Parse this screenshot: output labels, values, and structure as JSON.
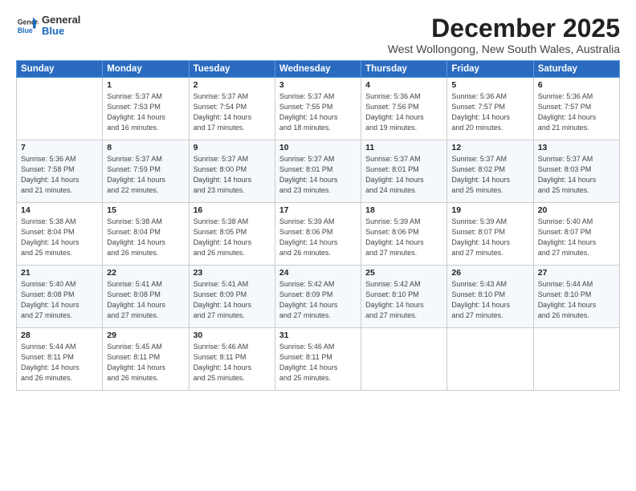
{
  "logo": {
    "general": "General",
    "blue": "Blue"
  },
  "title": "December 2025",
  "subtitle": "West Wollongong, New South Wales, Australia",
  "headers": [
    "Sunday",
    "Monday",
    "Tuesday",
    "Wednesday",
    "Thursday",
    "Friday",
    "Saturday"
  ],
  "weeks": [
    [
      {
        "day": "",
        "info": ""
      },
      {
        "day": "1",
        "info": "Sunrise: 5:37 AM\nSunset: 7:53 PM\nDaylight: 14 hours\nand 16 minutes."
      },
      {
        "day": "2",
        "info": "Sunrise: 5:37 AM\nSunset: 7:54 PM\nDaylight: 14 hours\nand 17 minutes."
      },
      {
        "day": "3",
        "info": "Sunrise: 5:37 AM\nSunset: 7:55 PM\nDaylight: 14 hours\nand 18 minutes."
      },
      {
        "day": "4",
        "info": "Sunrise: 5:36 AM\nSunset: 7:56 PM\nDaylight: 14 hours\nand 19 minutes."
      },
      {
        "day": "5",
        "info": "Sunrise: 5:36 AM\nSunset: 7:57 PM\nDaylight: 14 hours\nand 20 minutes."
      },
      {
        "day": "6",
        "info": "Sunrise: 5:36 AM\nSunset: 7:57 PM\nDaylight: 14 hours\nand 21 minutes."
      }
    ],
    [
      {
        "day": "7",
        "info": "Sunrise: 5:36 AM\nSunset: 7:58 PM\nDaylight: 14 hours\nand 21 minutes."
      },
      {
        "day": "8",
        "info": "Sunrise: 5:37 AM\nSunset: 7:59 PM\nDaylight: 14 hours\nand 22 minutes."
      },
      {
        "day": "9",
        "info": "Sunrise: 5:37 AM\nSunset: 8:00 PM\nDaylight: 14 hours\nand 23 minutes."
      },
      {
        "day": "10",
        "info": "Sunrise: 5:37 AM\nSunset: 8:01 PM\nDaylight: 14 hours\nand 23 minutes."
      },
      {
        "day": "11",
        "info": "Sunrise: 5:37 AM\nSunset: 8:01 PM\nDaylight: 14 hours\nand 24 minutes."
      },
      {
        "day": "12",
        "info": "Sunrise: 5:37 AM\nSunset: 8:02 PM\nDaylight: 14 hours\nand 25 minutes."
      },
      {
        "day": "13",
        "info": "Sunrise: 5:37 AM\nSunset: 8:03 PM\nDaylight: 14 hours\nand 25 minutes."
      }
    ],
    [
      {
        "day": "14",
        "info": "Sunrise: 5:38 AM\nSunset: 8:04 PM\nDaylight: 14 hours\nand 25 minutes."
      },
      {
        "day": "15",
        "info": "Sunrise: 5:38 AM\nSunset: 8:04 PM\nDaylight: 14 hours\nand 26 minutes."
      },
      {
        "day": "16",
        "info": "Sunrise: 5:38 AM\nSunset: 8:05 PM\nDaylight: 14 hours\nand 26 minutes."
      },
      {
        "day": "17",
        "info": "Sunrise: 5:39 AM\nSunset: 8:06 PM\nDaylight: 14 hours\nand 26 minutes."
      },
      {
        "day": "18",
        "info": "Sunrise: 5:39 AM\nSunset: 8:06 PM\nDaylight: 14 hours\nand 27 minutes."
      },
      {
        "day": "19",
        "info": "Sunrise: 5:39 AM\nSunset: 8:07 PM\nDaylight: 14 hours\nand 27 minutes."
      },
      {
        "day": "20",
        "info": "Sunrise: 5:40 AM\nSunset: 8:07 PM\nDaylight: 14 hours\nand 27 minutes."
      }
    ],
    [
      {
        "day": "21",
        "info": "Sunrise: 5:40 AM\nSunset: 8:08 PM\nDaylight: 14 hours\nand 27 minutes."
      },
      {
        "day": "22",
        "info": "Sunrise: 5:41 AM\nSunset: 8:08 PM\nDaylight: 14 hours\nand 27 minutes."
      },
      {
        "day": "23",
        "info": "Sunrise: 5:41 AM\nSunset: 8:09 PM\nDaylight: 14 hours\nand 27 minutes."
      },
      {
        "day": "24",
        "info": "Sunrise: 5:42 AM\nSunset: 8:09 PM\nDaylight: 14 hours\nand 27 minutes."
      },
      {
        "day": "25",
        "info": "Sunrise: 5:42 AM\nSunset: 8:10 PM\nDaylight: 14 hours\nand 27 minutes."
      },
      {
        "day": "26",
        "info": "Sunrise: 5:43 AM\nSunset: 8:10 PM\nDaylight: 14 hours\nand 27 minutes."
      },
      {
        "day": "27",
        "info": "Sunrise: 5:44 AM\nSunset: 8:10 PM\nDaylight: 14 hours\nand 26 minutes."
      }
    ],
    [
      {
        "day": "28",
        "info": "Sunrise: 5:44 AM\nSunset: 8:11 PM\nDaylight: 14 hours\nand 26 minutes."
      },
      {
        "day": "29",
        "info": "Sunrise: 5:45 AM\nSunset: 8:11 PM\nDaylight: 14 hours\nand 26 minutes."
      },
      {
        "day": "30",
        "info": "Sunrise: 5:46 AM\nSunset: 8:11 PM\nDaylight: 14 hours\nand 25 minutes."
      },
      {
        "day": "31",
        "info": "Sunrise: 5:46 AM\nSunset: 8:11 PM\nDaylight: 14 hours\nand 25 minutes."
      },
      {
        "day": "",
        "info": ""
      },
      {
        "day": "",
        "info": ""
      },
      {
        "day": "",
        "info": ""
      }
    ]
  ]
}
